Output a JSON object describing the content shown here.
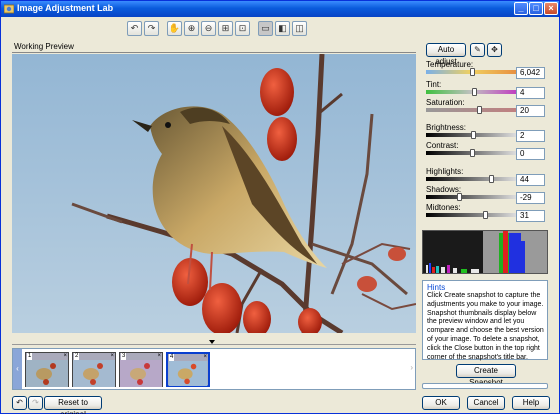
{
  "window": {
    "title": "Image Adjustment Lab",
    "controls": [
      "minimize",
      "maximize",
      "close"
    ]
  },
  "toolbar": {
    "icons": [
      "rotate-left-icon",
      "rotate-right-icon",
      "pan-icon",
      "zoom-in-icon",
      "zoom-out-icon",
      "fit-to-window-icon",
      "actual-size-icon",
      "single-view-icon",
      "split-view-icon",
      "side-by-side-view-icon"
    ]
  },
  "preview": {
    "label": "Working Preview"
  },
  "controls": {
    "auto_adjust": "Auto adjust",
    "sliders": [
      {
        "label": "Temperature:",
        "value": "6,042",
        "level": 0.5
      },
      {
        "label": "Tint:",
        "value": "4",
        "level": 0.52
      },
      {
        "label": "Saturation:",
        "value": "20",
        "level": 0.58
      },
      {
        "label": "Brightness:",
        "value": "2",
        "level": 0.51
      },
      {
        "label": "Contrast:",
        "value": "0",
        "level": 0.5
      },
      {
        "label": "Highlights:",
        "value": "44",
        "level": 0.72
      },
      {
        "label": "Shadows:",
        "value": "-29",
        "level": 0.35
      },
      {
        "label": "Midtones:",
        "value": "31",
        "level": 0.65
      }
    ]
  },
  "hints": {
    "title": "Hints",
    "text": "Click Create snapshot to capture the adjustments you make to your image. Snapshot thumbnails display below the preview window and let you compare and choose the best version of your image. To delete a snapshot, click the Close button in the top right corner of the snapshot's title bar."
  },
  "snapshots": [
    {
      "number": "1",
      "close": "×"
    },
    {
      "number": "2",
      "close": "×"
    },
    {
      "number": "3",
      "close": "×"
    },
    {
      "number": "4",
      "close": "×"
    }
  ],
  "buttons": {
    "reset": "Reset to original",
    "create_snapshot": "Create Snapshot",
    "ok": "OK",
    "cancel": "Cancel",
    "help": "Help"
  },
  "colors": {
    "title_bar": "#0a5bdc",
    "window_bg": "#ece9d8",
    "hints_title": "#0a4bd6"
  }
}
